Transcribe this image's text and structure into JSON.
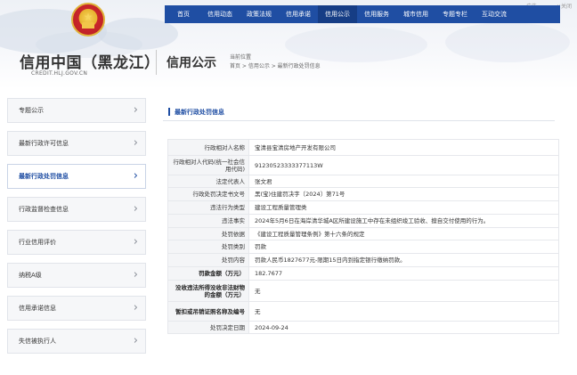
{
  "header": {
    "site_title": "信用中国（黑龙江）",
    "site_url": "CREDIT.HLJ.GOV.CN",
    "section_title": "信用公示",
    "breadcrumb_label": "当前位置",
    "breadcrumb": "首页 > 信用公示 > 最新行政处罚信息",
    "ad_badge": "广告",
    "ad_close": "×关闭"
  },
  "nav": {
    "items": [
      {
        "label": "首页"
      },
      {
        "label": "信用动态"
      },
      {
        "label": "政策法规"
      },
      {
        "label": "信用承诺"
      },
      {
        "label": "信用公示"
      },
      {
        "label": "信用服务"
      },
      {
        "label": "城市信用"
      },
      {
        "label": "专题专栏"
      },
      {
        "label": "互动交流"
      }
    ],
    "active_index": 4
  },
  "sidebar": {
    "items": [
      {
        "label": "专题公示"
      },
      {
        "label": "最新行政许可信息"
      },
      {
        "label": "最新行政处罚信息"
      },
      {
        "label": "行政监督检查信息"
      },
      {
        "label": "行业信用评价"
      },
      {
        "label": "纳税A级"
      },
      {
        "label": "信用承诺信息"
      },
      {
        "label": "失信被执行人"
      }
    ],
    "active_index": 2
  },
  "content": {
    "heading": "最新行政处罚信息",
    "rows": [
      {
        "key": "行政相对人名称",
        "value": "宝清县宝清房地产开发有限公司"
      },
      {
        "key": "行政相对人代码(统一社会信用代码)",
        "value": "91230523333377113W"
      },
      {
        "key": "法定代表人",
        "value": "张文君"
      },
      {
        "key": "行政处罚决定书文号",
        "value": "黑(宝)住建罚决字〔2024〕第71号"
      },
      {
        "key": "违法行为类型",
        "value": "建设工程质量管理类"
      },
      {
        "key": "违法事实",
        "value": "2024年5月6日在海岸清华城A区所建设施工中存在未组织竣工验收、擅自交付使用的行为。"
      },
      {
        "key": "处罚依据",
        "value": "《建设工程质量管理条例》第十六条的规定"
      },
      {
        "key": "处罚类别",
        "value": "罚款"
      },
      {
        "key": "处罚内容",
        "value": "罚款人民币1827677元-限期15日内到指定银行缴纳罚款。"
      },
      {
        "key": "罚款金额（万元）",
        "value": "182.7677"
      },
      {
        "key": "没收违法所得没收非法财物的金额（万元）",
        "value": "无"
      },
      {
        "key": "暂扣或吊销证照名称及编号",
        "value": "无"
      },
      {
        "key": "处罚决定日期",
        "value": "2024-09-24"
      }
    ]
  },
  "colors": {
    "nav_blue": "#1f4ea3",
    "key_bg": "#f4f5f7"
  }
}
